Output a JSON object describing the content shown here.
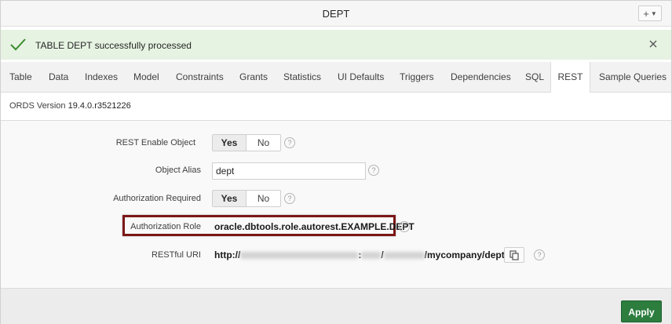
{
  "window": {
    "title": "DEPT",
    "add_button": "+"
  },
  "alert": {
    "message": "TABLE DEPT successfully processed"
  },
  "tabs": [
    {
      "label": "Table"
    },
    {
      "label": "Data"
    },
    {
      "label": "Indexes"
    },
    {
      "label": "Model"
    },
    {
      "label": "Constraints"
    },
    {
      "label": "Grants"
    },
    {
      "label": "Statistics"
    },
    {
      "label": "UI Defaults"
    },
    {
      "label": "Triggers"
    },
    {
      "label": "Dependencies"
    },
    {
      "label": "SQL"
    },
    {
      "label": "REST"
    },
    {
      "label": "Sample Queries"
    }
  ],
  "active_tab": "REST",
  "ords": {
    "label": "ORDS Version",
    "version": "19.4.0.r3521226"
  },
  "form": {
    "rest_enable": {
      "label": "REST Enable Object",
      "yes": "Yes",
      "no": "No",
      "selected": "Yes"
    },
    "object_alias": {
      "label": "Object Alias",
      "value": "dept"
    },
    "auth_required": {
      "label": "Authorization Required",
      "yes": "Yes",
      "no": "No",
      "selected": "Yes"
    },
    "auth_role": {
      "label": "Authorization Role",
      "value": "oracle.dbtools.role.autorest.EXAMPLE.DEPT"
    },
    "restful_uri": {
      "label": "RESTful URI",
      "prefix": "http://",
      "colon": ":",
      "slash": "/",
      "suffix": "/mycompany/dept/"
    }
  },
  "help_glyph": "?",
  "footer": {
    "apply_label": "Apply"
  },
  "colors": {
    "success_bg": "#e6f3e2",
    "success_check": "#3b8c2e",
    "apply_bg": "#2c7d3e",
    "highlight_border": "#7c1717"
  },
  "icons": [
    "check-icon",
    "close-icon",
    "help-icon",
    "copy-icon",
    "plus-icon"
  ]
}
